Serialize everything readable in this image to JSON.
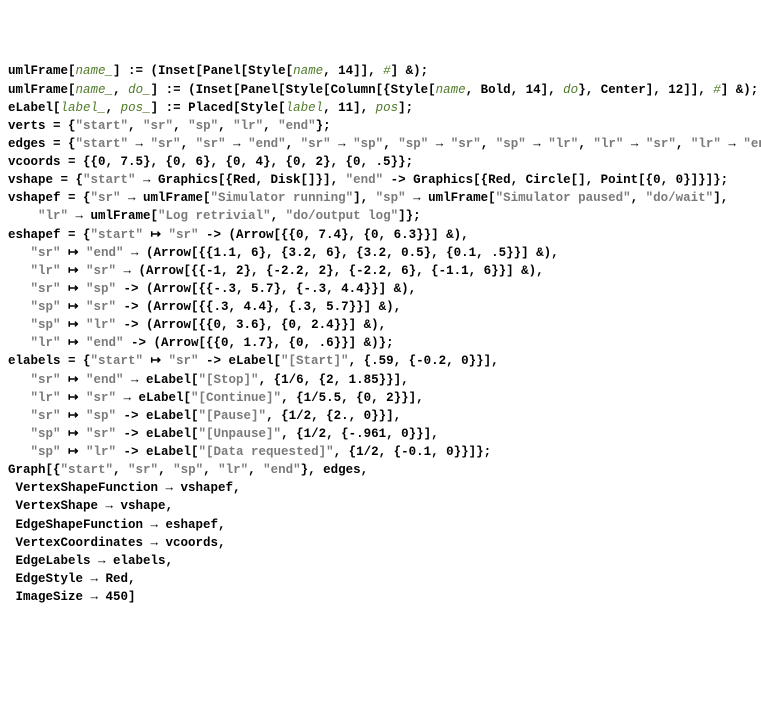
{
  "lines": [
    {
      "t": "def",
      "parts": [
        {
          "c": "b",
          "v": "umlFrame"
        },
        {
          "c": "b",
          "v": "["
        },
        {
          "c": "i",
          "v": "name_"
        },
        {
          "c": "b",
          "v": "] := (Inset[Panel[Style["
        },
        {
          "c": "i",
          "v": "name"
        },
        {
          "c": "b",
          "v": ", 14]], "
        },
        {
          "c": "i",
          "v": "#"
        },
        {
          "c": "b",
          "v": "] &);"
        }
      ]
    },
    {
      "t": "def",
      "parts": [
        {
          "c": "b",
          "v": "umlFrame"
        },
        {
          "c": "b",
          "v": "["
        },
        {
          "c": "i",
          "v": "name_"
        },
        {
          "c": "b",
          "v": ", "
        },
        {
          "c": "i",
          "v": "do_"
        },
        {
          "c": "b",
          "v": "] := (Inset[Panel[Style[Column[{Style["
        },
        {
          "c": "i",
          "v": "name"
        },
        {
          "c": "b",
          "v": ", Bold, 14], "
        },
        {
          "c": "i",
          "v": "do"
        },
        {
          "c": "b",
          "v": "}, Center], 12]], "
        },
        {
          "c": "i",
          "v": "#"
        },
        {
          "c": "b",
          "v": "] &);"
        }
      ]
    },
    {
      "t": "def",
      "parts": [
        {
          "c": "b",
          "v": "eLabel"
        },
        {
          "c": "b",
          "v": "["
        },
        {
          "c": "i",
          "v": "label_"
        },
        {
          "c": "b",
          "v": ", "
        },
        {
          "c": "i",
          "v": "pos_"
        },
        {
          "c": "b",
          "v": "] := Placed[Style["
        },
        {
          "c": "i",
          "v": "label"
        },
        {
          "c": "b",
          "v": ", 11], "
        },
        {
          "c": "i",
          "v": "pos"
        },
        {
          "c": "b",
          "v": "];"
        }
      ]
    },
    {
      "t": "assign",
      "parts": [
        {
          "c": "b",
          "v": "verts = {"
        },
        {
          "c": "s",
          "v": "\"start\""
        },
        {
          "c": "b",
          "v": ", "
        },
        {
          "c": "s",
          "v": "\"sr\""
        },
        {
          "c": "b",
          "v": ", "
        },
        {
          "c": "s",
          "v": "\"sp\""
        },
        {
          "c": "b",
          "v": ", "
        },
        {
          "c": "s",
          "v": "\"lr\""
        },
        {
          "c": "b",
          "v": ", "
        },
        {
          "c": "s",
          "v": "\"end\""
        },
        {
          "c": "b",
          "v": "};"
        }
      ]
    },
    {
      "t": "assign",
      "parts": [
        {
          "c": "b",
          "v": "edges = {"
        },
        {
          "c": "s",
          "v": "\"start\""
        },
        {
          "c": "b",
          "v": " → "
        },
        {
          "c": "s",
          "v": "\"sr\""
        },
        {
          "c": "b",
          "v": ", "
        },
        {
          "c": "s",
          "v": "\"sr\""
        },
        {
          "c": "b",
          "v": " → "
        },
        {
          "c": "s",
          "v": "\"end\""
        },
        {
          "c": "b",
          "v": ", "
        },
        {
          "c": "s",
          "v": "\"sr\""
        },
        {
          "c": "b",
          "v": " → "
        },
        {
          "c": "s",
          "v": "\"sp\""
        },
        {
          "c": "b",
          "v": ", "
        },
        {
          "c": "s",
          "v": "\"sp\""
        },
        {
          "c": "b",
          "v": " → "
        },
        {
          "c": "s",
          "v": "\"sr\""
        },
        {
          "c": "b",
          "v": ", "
        },
        {
          "c": "s",
          "v": "\"sp\""
        },
        {
          "c": "b",
          "v": " → "
        },
        {
          "c": "s",
          "v": "\"lr\""
        },
        {
          "c": "b",
          "v": ", "
        },
        {
          "c": "s",
          "v": "\"lr\""
        },
        {
          "c": "b",
          "v": " → "
        },
        {
          "c": "s",
          "v": "\"sr\""
        },
        {
          "c": "b",
          "v": ", "
        },
        {
          "c": "s",
          "v": "\"lr\""
        },
        {
          "c": "b",
          "v": " → "
        },
        {
          "c": "s",
          "v": "\"end\""
        },
        {
          "c": "b",
          "v": "};"
        }
      ]
    },
    {
      "t": "assign",
      "parts": [
        {
          "c": "b",
          "v": "vcoords = {{0, 7.5}, {0, 6}, {0, 4}, {0, 2}, {0, .5}};"
        }
      ]
    },
    {
      "t": "assign",
      "parts": [
        {
          "c": "b",
          "v": "vshape = {"
        },
        {
          "c": "s",
          "v": "\"start\""
        },
        {
          "c": "b",
          "v": " → Graphics[{Red, Disk[]}], "
        },
        {
          "c": "s",
          "v": "\"end\""
        },
        {
          "c": "b",
          "v": " -> Graphics[{Red, Circle[], Point[{0, 0}]}]};"
        }
      ]
    },
    {
      "t": "assign",
      "parts": [
        {
          "c": "b",
          "v": "vshapef = {"
        },
        {
          "c": "s",
          "v": "\"sr\""
        },
        {
          "c": "b",
          "v": " → umlFrame["
        },
        {
          "c": "s",
          "v": "\"Simulator running\""
        },
        {
          "c": "b",
          "v": "], "
        },
        {
          "c": "s",
          "v": "\"sp\""
        },
        {
          "c": "b",
          "v": " → umlFrame["
        },
        {
          "c": "s",
          "v": "\"Simulator paused\""
        },
        {
          "c": "b",
          "v": ", "
        },
        {
          "c": "s",
          "v": "\"do/wait\""
        },
        {
          "c": "b",
          "v": "],"
        }
      ]
    },
    {
      "t": "cont",
      "parts": [
        {
          "c": "b",
          "v": "    "
        },
        {
          "c": "s",
          "v": "\"lr\""
        },
        {
          "c": "b",
          "v": " → umlFrame["
        },
        {
          "c": "s",
          "v": "\"Log retrivial\""
        },
        {
          "c": "b",
          "v": ", "
        },
        {
          "c": "s",
          "v": "\"do/output log\""
        },
        {
          "c": "b",
          "v": "]};"
        }
      ]
    },
    {
      "t": "assign",
      "parts": [
        {
          "c": "b",
          "v": "eshapef = {"
        },
        {
          "c": "s",
          "v": "\"start\""
        },
        {
          "c": "b",
          "v": " ↦ "
        },
        {
          "c": "s",
          "v": "\"sr\""
        },
        {
          "c": "b",
          "v": " -> (Arrow[{{0, 7.4}, {0, 6.3}}] &),"
        }
      ]
    },
    {
      "t": "cont",
      "parts": [
        {
          "c": "b",
          "v": "   "
        },
        {
          "c": "s",
          "v": "\"sr\""
        },
        {
          "c": "b",
          "v": " ↦ "
        },
        {
          "c": "s",
          "v": "\"end\""
        },
        {
          "c": "b",
          "v": " → (Arrow[{{1.1, 6}, {3.2, 6}, {3.2, 0.5}, {0.1, .5}}] &),"
        }
      ]
    },
    {
      "t": "cont",
      "parts": [
        {
          "c": "b",
          "v": "   "
        },
        {
          "c": "s",
          "v": "\"lr\""
        },
        {
          "c": "b",
          "v": " ↦ "
        },
        {
          "c": "s",
          "v": "\"sr\""
        },
        {
          "c": "b",
          "v": " → (Arrow[{{-1, 2}, {-2.2, 2}, {-2.2, 6}, {-1.1, 6}}] &),"
        }
      ]
    },
    {
      "t": "cont",
      "parts": [
        {
          "c": "b",
          "v": "   "
        },
        {
          "c": "s",
          "v": "\"sr\""
        },
        {
          "c": "b",
          "v": " ↦ "
        },
        {
          "c": "s",
          "v": "\"sp\""
        },
        {
          "c": "b",
          "v": " -> (Arrow[{{-.3, 5.7}, {-.3, 4.4}}] &),"
        }
      ]
    },
    {
      "t": "cont",
      "parts": [
        {
          "c": "b",
          "v": "   "
        },
        {
          "c": "s",
          "v": "\"sp\""
        },
        {
          "c": "b",
          "v": " ↦ "
        },
        {
          "c": "s",
          "v": "\"sr\""
        },
        {
          "c": "b",
          "v": " -> (Arrow[{{.3, 4.4}, {.3, 5.7}}] &),"
        }
      ]
    },
    {
      "t": "cont",
      "parts": [
        {
          "c": "b",
          "v": "   "
        },
        {
          "c": "s",
          "v": "\"sp\""
        },
        {
          "c": "b",
          "v": " ↦ "
        },
        {
          "c": "s",
          "v": "\"lr\""
        },
        {
          "c": "b",
          "v": " -> (Arrow[{{0, 3.6}, {0, 2.4}}] &),"
        }
      ]
    },
    {
      "t": "cont",
      "parts": [
        {
          "c": "b",
          "v": "   "
        },
        {
          "c": "s",
          "v": "\"lr\""
        },
        {
          "c": "b",
          "v": " ↦ "
        },
        {
          "c": "s",
          "v": "\"end\""
        },
        {
          "c": "b",
          "v": " -> (Arrow[{{0, 1.7}, {0, .6}}] &)};"
        }
      ]
    },
    {
      "t": "assign",
      "parts": [
        {
          "c": "b",
          "v": "elabels = {"
        },
        {
          "c": "s",
          "v": "\"start\""
        },
        {
          "c": "b",
          "v": " ↦ "
        },
        {
          "c": "s",
          "v": "\"sr\""
        },
        {
          "c": "b",
          "v": " -> eLabel["
        },
        {
          "c": "s",
          "v": "\"[Start]\""
        },
        {
          "c": "b",
          "v": ", {.59, {-0.2, 0}}],"
        }
      ]
    },
    {
      "t": "cont",
      "parts": [
        {
          "c": "b",
          "v": "   "
        },
        {
          "c": "s",
          "v": "\"sr\""
        },
        {
          "c": "b",
          "v": " ↦ "
        },
        {
          "c": "s",
          "v": "\"end\""
        },
        {
          "c": "b",
          "v": " → eLabel["
        },
        {
          "c": "s",
          "v": "\"[Stop]\""
        },
        {
          "c": "b",
          "v": ", {1/6, {2, 1.85}}],"
        }
      ]
    },
    {
      "t": "cont",
      "parts": [
        {
          "c": "b",
          "v": "   "
        },
        {
          "c": "s",
          "v": "\"lr\""
        },
        {
          "c": "b",
          "v": " ↦ "
        },
        {
          "c": "s",
          "v": "\"sr\""
        },
        {
          "c": "b",
          "v": " → eLabel["
        },
        {
          "c": "s",
          "v": "\"[Continue]\""
        },
        {
          "c": "b",
          "v": ", {1/5.5, {0, 2}}],"
        }
      ]
    },
    {
      "t": "cont",
      "parts": [
        {
          "c": "b",
          "v": "   "
        },
        {
          "c": "s",
          "v": "\"sr\""
        },
        {
          "c": "b",
          "v": " ↦ "
        },
        {
          "c": "s",
          "v": "\"sp\""
        },
        {
          "c": "b",
          "v": " -> eLabel["
        },
        {
          "c": "s",
          "v": "\"[Pause]\""
        },
        {
          "c": "b",
          "v": ", {1/2, {2., 0}}],"
        }
      ]
    },
    {
      "t": "cont",
      "parts": [
        {
          "c": "b",
          "v": "   "
        },
        {
          "c": "s",
          "v": "\"sp\""
        },
        {
          "c": "b",
          "v": " ↦ "
        },
        {
          "c": "s",
          "v": "\"sr\""
        },
        {
          "c": "b",
          "v": " -> eLabel["
        },
        {
          "c": "s",
          "v": "\"[Unpause]\""
        },
        {
          "c": "b",
          "v": ", {1/2, {-.961, 0}}],"
        }
      ]
    },
    {
      "t": "cont",
      "parts": [
        {
          "c": "b",
          "v": "   "
        },
        {
          "c": "s",
          "v": "\"sp\""
        },
        {
          "c": "b",
          "v": " ↦ "
        },
        {
          "c": "s",
          "v": "\"lr\""
        },
        {
          "c": "b",
          "v": " -> eLabel["
        },
        {
          "c": "s",
          "v": "\"[Data requested]\""
        },
        {
          "c": "b",
          "v": ", {1/2, {-0.1, 0}}]};"
        }
      ]
    },
    {
      "t": "call",
      "parts": [
        {
          "c": "b",
          "v": "Graph[{"
        },
        {
          "c": "s",
          "v": "\"start\""
        },
        {
          "c": "b",
          "v": ", "
        },
        {
          "c": "s",
          "v": "\"sr\""
        },
        {
          "c": "b",
          "v": ", "
        },
        {
          "c": "s",
          "v": "\"sp\""
        },
        {
          "c": "b",
          "v": ", "
        },
        {
          "c": "s",
          "v": "\"lr\""
        },
        {
          "c": "b",
          "v": ", "
        },
        {
          "c": "s",
          "v": "\"end\""
        },
        {
          "c": "b",
          "v": "}, edges,"
        }
      ]
    },
    {
      "t": "cont",
      "parts": [
        {
          "c": "b",
          "v": " VertexShapeFunction → vshapef,"
        }
      ]
    },
    {
      "t": "cont",
      "parts": [
        {
          "c": "b",
          "v": " VertexShape → vshape,"
        }
      ]
    },
    {
      "t": "cont",
      "parts": [
        {
          "c": "b",
          "v": " EdgeShapeFunction → eshapef,"
        }
      ]
    },
    {
      "t": "cont",
      "parts": [
        {
          "c": "b",
          "v": " VertexCoordinates → vcoords,"
        }
      ]
    },
    {
      "t": "cont",
      "parts": [
        {
          "c": "b",
          "v": " EdgeLabels → elabels,"
        }
      ]
    },
    {
      "t": "cont",
      "parts": [
        {
          "c": "b",
          "v": " EdgeStyle → Red,"
        }
      ]
    },
    {
      "t": "cont",
      "parts": [
        {
          "c": "b",
          "v": " ImageSize → 450]"
        }
      ]
    }
  ]
}
